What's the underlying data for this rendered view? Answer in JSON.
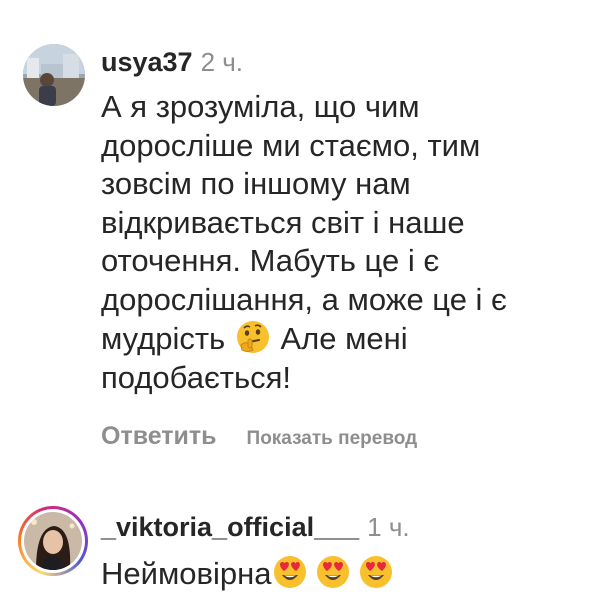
{
  "comments": [
    {
      "username": "usya37",
      "time": "2 ч.",
      "lines": [
        "А я зрозуміла, що чим",
        "доросліше ми стаємо, тим",
        "зовсім по іншому нам",
        "відкривається світ і наше",
        "оточення. Мабуть це і є",
        "дорослішання, а може це і є",
        "мудрість",
        "Але мені",
        "подобається!"
      ],
      "emoji": "thinking-face",
      "reply_label": "Ответить",
      "translate_label": "Показать перевод"
    },
    {
      "username": "_viktoria_official___",
      "time": "1 ч.",
      "text": "Неймовірна",
      "emoji": [
        "heart-eyes-face",
        "heart-eyes-face",
        "heart-eyes-face"
      ],
      "has_story_ring": true
    }
  ],
  "colors": {
    "text": "#262626",
    "muted": "#8e8e8e",
    "emoji_yellow": "#f7c02c",
    "heart_red": "#e8283c"
  }
}
